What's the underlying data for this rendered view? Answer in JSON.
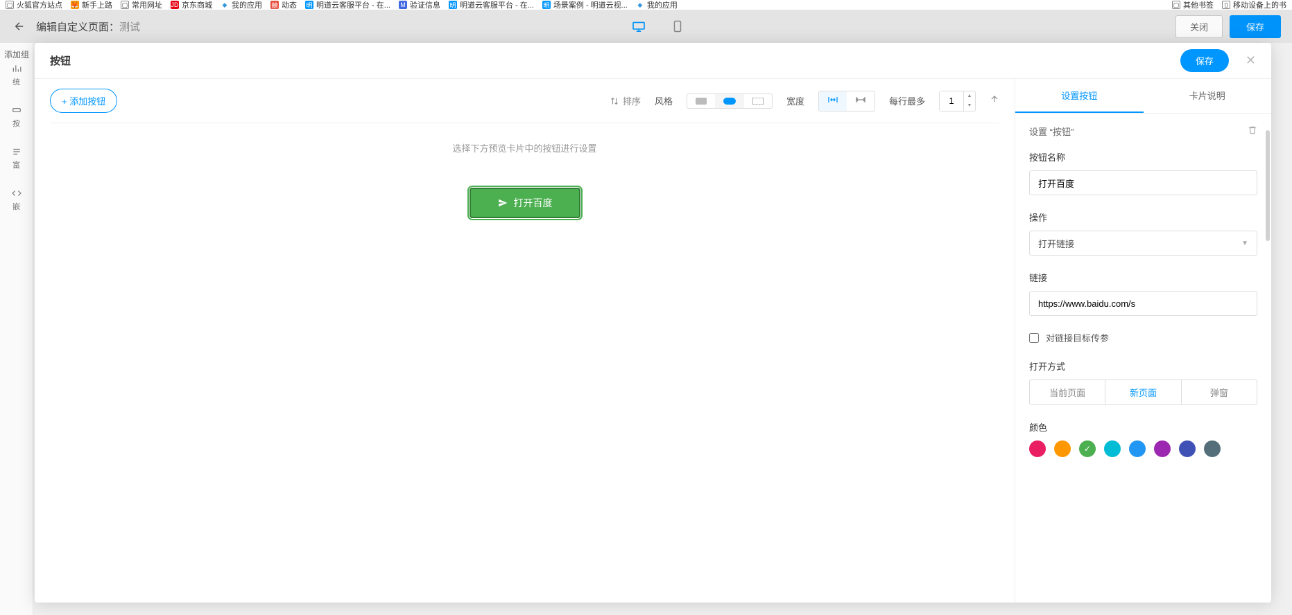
{
  "bookmarks": {
    "left": [
      {
        "icon": "page",
        "label": "火狐官方站点"
      },
      {
        "icon": "ff",
        "label": "新手上路"
      },
      {
        "icon": "page",
        "label": "常用网址"
      },
      {
        "icon": "jd",
        "label": "京东商城"
      },
      {
        "icon": "cube",
        "label": "我的应用"
      },
      {
        "icon": "red",
        "label": "动态"
      },
      {
        "icon": "md",
        "label": "明道云客服平台 - 在..."
      },
      {
        "icon": "m",
        "label": "验证信息"
      },
      {
        "icon": "md",
        "label": "明道云客服平台 - 在..."
      },
      {
        "icon": "md",
        "label": "场景案例 - 明道云视..."
      },
      {
        "icon": "cube",
        "label": "我的应用"
      }
    ],
    "right": [
      {
        "icon": "page",
        "label": "其他书签"
      },
      {
        "icon": "mob",
        "label": "移动设备上的书"
      }
    ]
  },
  "bg": {
    "title_prefix": "编辑自定义页面：",
    "title_value": "测试",
    "close": "关闭",
    "save": "保存"
  },
  "stub": {
    "header": "添加组",
    "items": [
      "统",
      "按",
      "富",
      "嵌"
    ]
  },
  "modal": {
    "title": "按钮",
    "save": "保存"
  },
  "toolbar": {
    "add_btn": "+ 添加按钮",
    "sort": "排序",
    "style_label": "风格",
    "width_label": "宽度",
    "per_row_label": "每行最多",
    "per_row_value": "1"
  },
  "hint": "选择下方预览卡片中的按钮进行设置",
  "preview": {
    "button_text": "打开百度"
  },
  "panel": {
    "tabs": {
      "t1": "设置按钮",
      "t2": "卡片说明"
    },
    "sub": "设置 “按钮”",
    "name_label": "按钮名称",
    "name_value": "打开百度",
    "op_label": "操作",
    "op_value": "打开链接",
    "link_label": "链接",
    "link_value": "https://www.baidu.com/s",
    "param_check": "对链接目标传参",
    "open_label": "打开方式",
    "open_opts": {
      "a": "当前页面",
      "b": "新页面",
      "c": "弹窗"
    },
    "color_label": "颜色",
    "colors": [
      "#e91e63",
      "#ff9800",
      "#4caf50",
      "#00bcd4",
      "#2196f3",
      "#9c27b0",
      "#3f51b5",
      "#607d8b"
    ]
  }
}
